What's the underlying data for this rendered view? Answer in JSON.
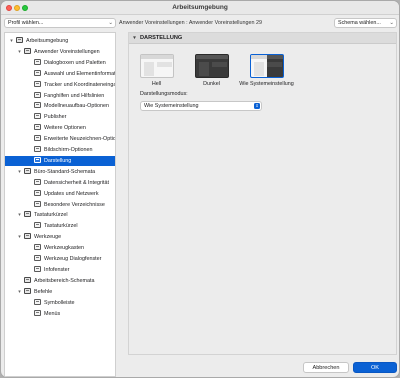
{
  "window": {
    "title": "Arbeitsumgebung"
  },
  "topbar": {
    "profile_select": "Profil wählen...",
    "breadcrumb": "Anwender Voreinstellungen : Anwender Voreinstellungen 29",
    "schema_select": "Schema wählen..."
  },
  "sidebar": {
    "items": [
      {
        "label": "Arbeitsumgebung",
        "level": 0,
        "twisty": "▾",
        "icon": "workspace-icon"
      },
      {
        "label": "Anwender Voreinstellungen",
        "level": 1,
        "twisty": "▾",
        "icon": "user-preferences-icon"
      },
      {
        "label": "Dialogboxen und Paletten",
        "level": 2,
        "twisty": "",
        "icon": "dialog-icon"
      },
      {
        "label": "Auswahl und Elementinformation",
        "level": 2,
        "twisty": "",
        "icon": "selection-icon"
      },
      {
        "label": "Tracker und Koordinateneingabe",
        "level": 2,
        "twisty": "",
        "icon": "tracker-icon"
      },
      {
        "label": "Fanghilfen und Hilfslinien",
        "level": 2,
        "twisty": "",
        "icon": "snap-icon"
      },
      {
        "label": "Modellneuaufbau-Optionen",
        "level": 2,
        "twisty": "",
        "icon": "rebuild-icon"
      },
      {
        "label": "Publisher",
        "level": 2,
        "twisty": "",
        "icon": "publisher-icon"
      },
      {
        "label": "Weitere Optionen",
        "level": 2,
        "twisty": "",
        "icon": "more-options-icon"
      },
      {
        "label": "Erweiterte Neuzeichnen-Optionen",
        "level": 2,
        "twisty": "",
        "icon": "redraw-icon"
      },
      {
        "label": "Bildschirm-Optionen",
        "level": 2,
        "twisty": "",
        "icon": "screen-icon"
      },
      {
        "label": "Darstellung",
        "level": 2,
        "twisty": "",
        "icon": "appearance-icon",
        "selected": true
      },
      {
        "label": "Büro-Standard-Schemata",
        "level": 1,
        "twisty": "▾",
        "icon": "company-schemes-icon"
      },
      {
        "label": "Datensicherheit & Integrität",
        "level": 2,
        "twisty": "",
        "icon": "data-safety-icon"
      },
      {
        "label": "Updates und Netzwerk",
        "level": 2,
        "twisty": "",
        "icon": "network-icon"
      },
      {
        "label": "Besondere Verzeichnisse",
        "level": 2,
        "twisty": "",
        "icon": "folders-icon"
      },
      {
        "label": "Tastaturkürzel",
        "level": 1,
        "twisty": "▾",
        "icon": "keyboard-icon"
      },
      {
        "label": "Tastaturkürzel",
        "level": 2,
        "twisty": "",
        "icon": "shortcut-icon"
      },
      {
        "label": "Werkzeuge",
        "level": 1,
        "twisty": "▾",
        "icon": "tools-icon"
      },
      {
        "label": "Werkzeugkasten",
        "level": 2,
        "twisty": "",
        "icon": "toolbox-icon"
      },
      {
        "label": "Werkzeug Dialogfenster",
        "level": 2,
        "twisty": "",
        "icon": "tool-dialog-icon"
      },
      {
        "label": "Infofenster",
        "level": 2,
        "twisty": "",
        "icon": "info-box-icon"
      },
      {
        "label": "Arbeitsbereich-Schemata",
        "level": 1,
        "twisty": "",
        "icon": "work-environment-icon"
      },
      {
        "label": "Befehle",
        "level": 1,
        "twisty": "▾",
        "icon": "commands-icon"
      },
      {
        "label": "Symbolleiste",
        "level": 2,
        "twisty": "",
        "icon": "toolbar-icon"
      },
      {
        "label": "Menüs",
        "level": 2,
        "twisty": "",
        "icon": "menus-icon"
      }
    ]
  },
  "content": {
    "section_title": "DARSTELLUNG",
    "themes": [
      {
        "label": "Hell"
      },
      {
        "label": "Dunkel"
      },
      {
        "label": "Wie Systemeinstellung",
        "selected": true
      }
    ],
    "mode_label": "Darstellungsmodus:",
    "mode_value": "Wie Systemeinstellung"
  },
  "buttons": {
    "cancel": "Abbrechen",
    "ok": "OK"
  },
  "colors": {
    "accent": "#0a61d4",
    "close": "#fe5f57",
    "minimize": "#febc2e",
    "maximize": "#28c840"
  }
}
